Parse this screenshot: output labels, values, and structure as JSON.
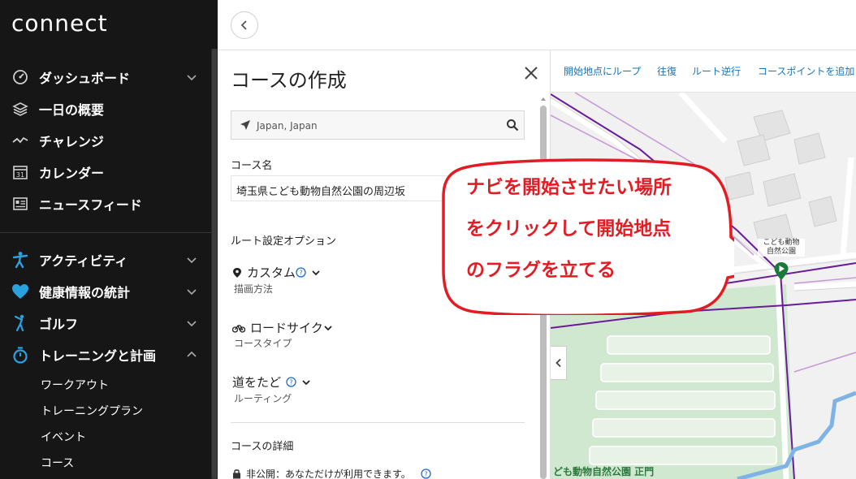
{
  "app": {
    "logo": "connect"
  },
  "sidebar": {
    "items": [
      {
        "label": "ダッシュボード",
        "icon": "gauge-icon",
        "expandable": true
      },
      {
        "label": "一日の概要",
        "icon": "layers-icon",
        "expandable": false
      },
      {
        "label": "チャレンジ",
        "icon": "challenge-icon",
        "expandable": false
      },
      {
        "label": "カレンダー",
        "icon": "calendar-icon",
        "expandable": false
      },
      {
        "label": "ニュースフィード",
        "icon": "newsfeed-icon",
        "expandable": false
      },
      {
        "label": "アクティビティ",
        "icon": "running-person-icon",
        "expandable": true
      },
      {
        "label": "健康情報の統計",
        "icon": "heart-icon",
        "expandable": true
      },
      {
        "label": "ゴルフ",
        "icon": "golf-icon",
        "expandable": true
      },
      {
        "label": "トレーニングと計画",
        "icon": "stopwatch-icon",
        "expandable": true,
        "expanded": true
      }
    ],
    "calendar_icon_number": "31",
    "subitems": [
      "ワークアウト",
      "トレーニングプラン",
      "イベント",
      "コース"
    ]
  },
  "panel": {
    "title": "コースの作成",
    "search_value": "Japan, Japan",
    "course_name_label": "コース名",
    "course_name_value": "埼玉県こども動物自然公園の周辺坂",
    "route_options_label": "ルート設定オプション",
    "options": [
      {
        "main": "カスタム",
        "sub": "描画方法",
        "icon": "pin-icon",
        "help": true
      },
      {
        "main": "ロードサイク",
        "sub": "コースタイプ",
        "icon": "bicycle-icon",
        "help": false
      },
      {
        "main": "道をたど",
        "sub": "ルーティング",
        "icon": "",
        "help": true
      }
    ],
    "details_label": "コースの詳細",
    "privacy_text": "非公開：あなただけが利用できます。"
  },
  "map": {
    "toolbar": [
      "開始地点にループ",
      "往復",
      "ルート逆行",
      "コースポイントを追加"
    ],
    "place_label_line1": "こども動物",
    "place_label_line2": "自然公園",
    "gate_label": "ども動物自然公園 正門"
  },
  "callout": {
    "lines": [
      "ナビを開始させたい場所",
      "をクリックして開始地点",
      "のフラグを立てる"
    ]
  },
  "colors": {
    "sidebar_bg": "#161616",
    "link_blue": "#1a73b8",
    "callout_red": "#e31c24",
    "route_purple": "#6a1b9a",
    "flag_green": "#1b7a3a",
    "help_blue": "#1a6fd1"
  }
}
